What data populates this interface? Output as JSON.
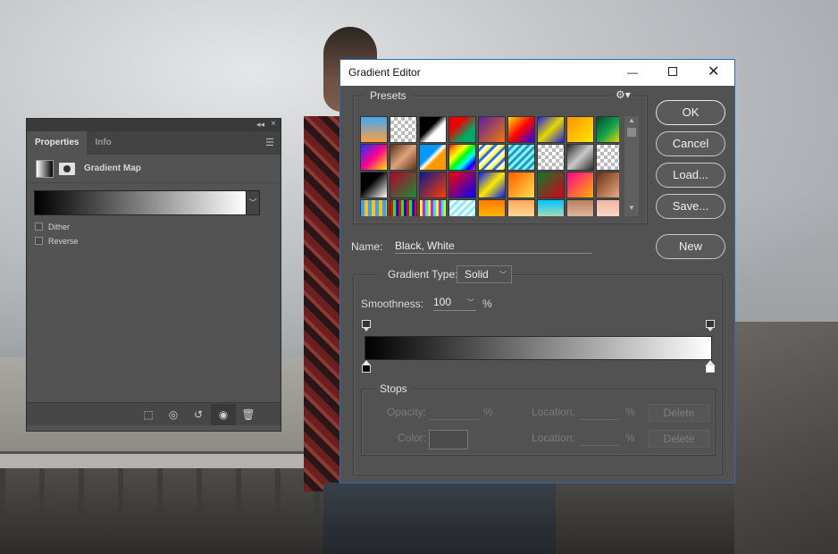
{
  "properties": {
    "tabs": [
      {
        "label": "Properties",
        "active": true
      },
      {
        "label": "Info",
        "active": false
      }
    ],
    "layer_label": "Gradient Map",
    "gradient_from": "#000000",
    "gradient_to": "#ffffff",
    "options": [
      {
        "label": "Dither",
        "checked": false
      },
      {
        "label": "Reverse",
        "checked": false
      }
    ],
    "footer_icons": [
      "clip-to-layer-icon",
      "view-previous-state-icon",
      "reset-icon",
      "visibility-icon",
      "delete-icon"
    ]
  },
  "gradient_editor": {
    "title": "Gradient Editor",
    "presets_label": "Presets",
    "buttons": {
      "ok": "OK",
      "cancel": "Cancel",
      "load": "Load...",
      "save": "Save...",
      "new": "New"
    },
    "name_label": "Name:",
    "name_value": "Black, White",
    "gradient_type_label": "Gradient Type:",
    "gradient_type_value": "Solid",
    "smoothness_label": "Smoothness:",
    "smoothness_value": "100",
    "percent": "%",
    "stops": {
      "label": "Stops",
      "opacity_label": "Opacity:",
      "location_label": "Location:",
      "color_label": "Color:",
      "delete_label": "Delete"
    },
    "preset_swatches": [
      "linear-gradient(180deg,#3fa9f5,#ff9f43)",
      "repeating-conic-gradient(#bbb 0 25%,#fff 0 50%) 0 0/8px 8px",
      "linear-gradient(135deg,#000 40%,#fff 60%)",
      "linear-gradient(135deg,#e00 30%,#0a6 70%)",
      "linear-gradient(135deg,#5c1ea0,#f07a0a)",
      "linear-gradient(135deg,#ffde00,#ff0000,#2000ff)",
      "linear-gradient(135deg,#1c1cf0,#e5d800,#1c1cf0)",
      "linear-gradient(135deg,#ff9300,#ffe600)",
      "linear-gradient(135deg,#004e2e,#16a34a,#ffe000)",
      "linear-gradient(135deg,#1737ff,#ff0090,#ffe600)",
      "linear-gradient(135deg,#5a3018,#e0a27c,#5a3018)",
      "linear-gradient(135deg,#0099ff 40%,#fff 50%,#ff9900 60%)",
      "linear-gradient(135deg,red,orange,yellow,lime,cyan,blue,magenta)",
      "repeating-linear-gradient(135deg,#ff3 0 3px,#2d6cff 3px 6px,#fff 6px 9px)",
      "repeating-linear-gradient(135deg,#8ee 0 3px,#1a99c4 3px 6px)",
      "repeating-conic-gradient(#bbb 0 25%,#fff 0 50%) 0 0/8px 8px",
      "linear-gradient(135deg,#2a2a2a,#c9c9c9,#2a2a2a)",
      "repeating-conic-gradient(#bbb 0 25%,#fff 0 50%) 0 0/8px 8px",
      "linear-gradient(135deg,#000 40%,#fff)",
      "linear-gradient(135deg,#b5002c,#1a8f3a)",
      "linear-gradient(135deg,#0a1a8c,#ff3c00)",
      "linear-gradient(135deg,#ff0000,#0000ff)",
      "linear-gradient(135deg,#0018ff,#ffe800,#0018ff)",
      "linear-gradient(135deg,#ff5a00,#ffe24a)",
      "linear-gradient(135deg,#0a7c2b,#d9001b)",
      "linear-gradient(135deg,#ff0090,#ffb200)",
      "linear-gradient(135deg,#6b3014,#f3b38a)",
      "repeating-linear-gradient(90deg,#3aa0ff 0 4px,#ffc400 4px 8px)",
      "repeating-linear-gradient(90deg,#ff0000 0 3px,#00ff00 3px 6px,#0000ff 6px 9px)",
      "repeating-linear-gradient(90deg,#ff0 0 3px,#f0f 3px 6px,#0ff 6px 9px)",
      "repeating-linear-gradient(135deg,#8ef 0 3px,#ffffff 3px 6px)",
      "linear-gradient(180deg,#ff7a00,#ffd500)",
      "linear-gradient(180deg,#ffa85a,#fff0b0)",
      "linear-gradient(180deg,#00c6ff,#ffe58a)",
      "linear-gradient(180deg,#b98062,#f6d4bf)",
      "linear-gradient(180deg,#f2b7a2,#ffe8d8)"
    ]
  }
}
